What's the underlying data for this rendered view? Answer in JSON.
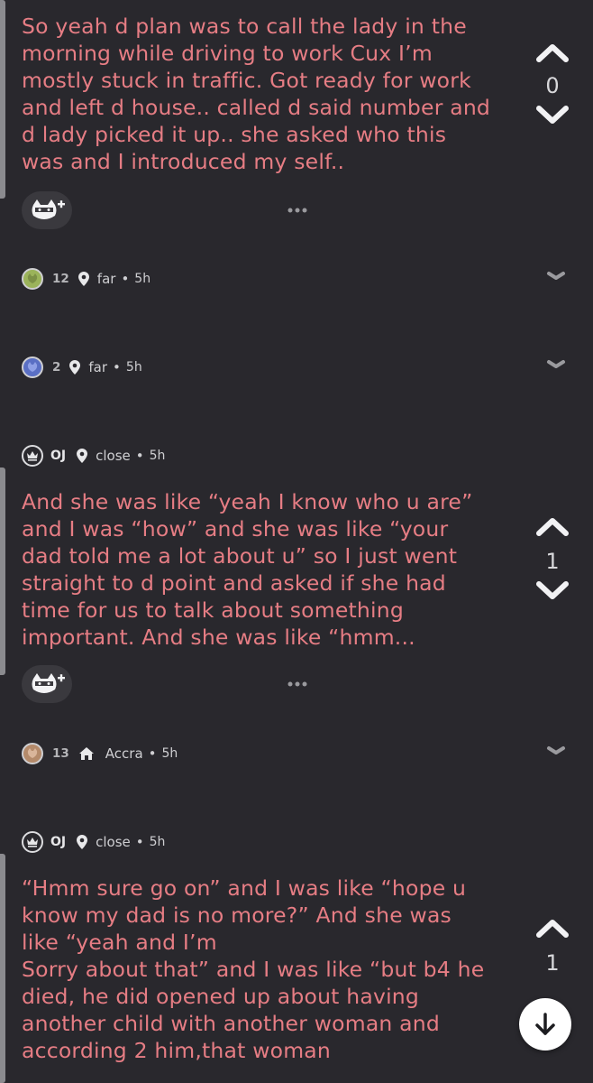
{
  "posts": [
    {
      "text": "So yeah d plan was to call the lady in the\nmorning while driving to work Cux I’m\nmostly stuck in traffic. Got ready for work\nand left d house.. called d said number and\nd lady picked it up.. she asked who this\nwas and I introduced my self..",
      "votes": "0"
    },
    {
      "text": "And she was like “yeah I know who u are”\nand I was “how” and she was like “your\ndad told me a lot about u” so I just went\nstraight to d point and asked if she had\ntime for us to talk about something\nimportant. And she was like “hmm...",
      "votes": "1"
    },
    {
      "text": "“Hmm sure go on” and I was like “hope u\nknow my dad is no more?” And she was\nlike “yeah and I’m\nSorry about that” and I was like “but b4 he\ndied, he did opened up about having\nanother child with another woman and\naccording 2 him,that woman",
      "votes": "1"
    }
  ],
  "replies": [
    {
      "count": "12",
      "location": "far",
      "time": "5h",
      "avatar_color": "#9bb35a"
    },
    {
      "count": "2",
      "location": "far",
      "time": "5h",
      "avatar_color": "#5a6fc4"
    },
    {
      "count": "13",
      "location": "Accra",
      "time": "5h",
      "avatar_color": "#b48a6a"
    }
  ],
  "op_meta": [
    {
      "label": "OJ",
      "location": "close",
      "time": "5h"
    },
    {
      "label": "OJ",
      "location": "close",
      "time": "5h"
    }
  ],
  "icons": {
    "upvote": "chevron-up-icon",
    "downvote": "chevron-down-icon",
    "react": "cat-mask-plus-icon",
    "more": "more-dots-icon",
    "location": "location-pin-icon",
    "home": "home-icon",
    "op": "crown-icon",
    "scroll": "arrow-down-icon"
  },
  "colors": {
    "background": "#29282d",
    "post_text": "#e67d84",
    "vote_count": "#d7d7da"
  }
}
